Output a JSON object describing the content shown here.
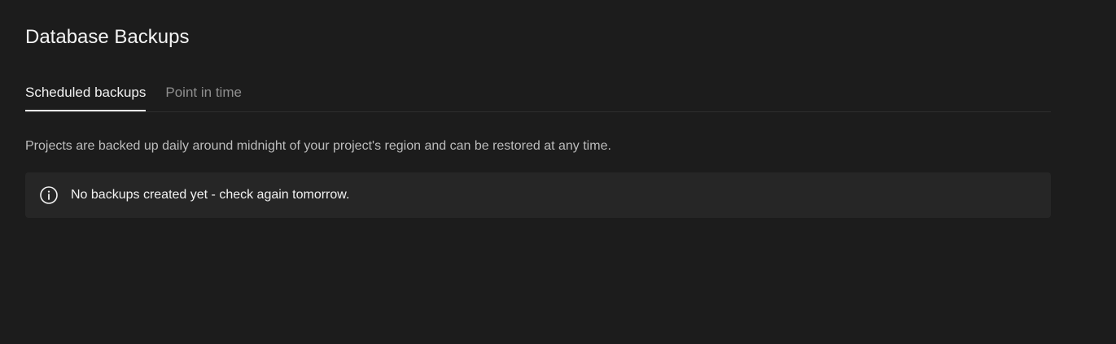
{
  "page": {
    "title": "Database Backups"
  },
  "tabs": [
    {
      "label": "Scheduled backups",
      "active": true
    },
    {
      "label": "Point in time",
      "active": false
    }
  ],
  "description": "Projects are backed up daily around midnight of your project's region and can be restored at any time.",
  "notice": {
    "icon": "info-icon",
    "text": "No backups created yet - check again tomorrow."
  },
  "colors": {
    "background": "#1c1c1c",
    "notice_background": "#262626",
    "text_primary": "#f2f2f2",
    "text_muted": "#8f8f8f"
  }
}
